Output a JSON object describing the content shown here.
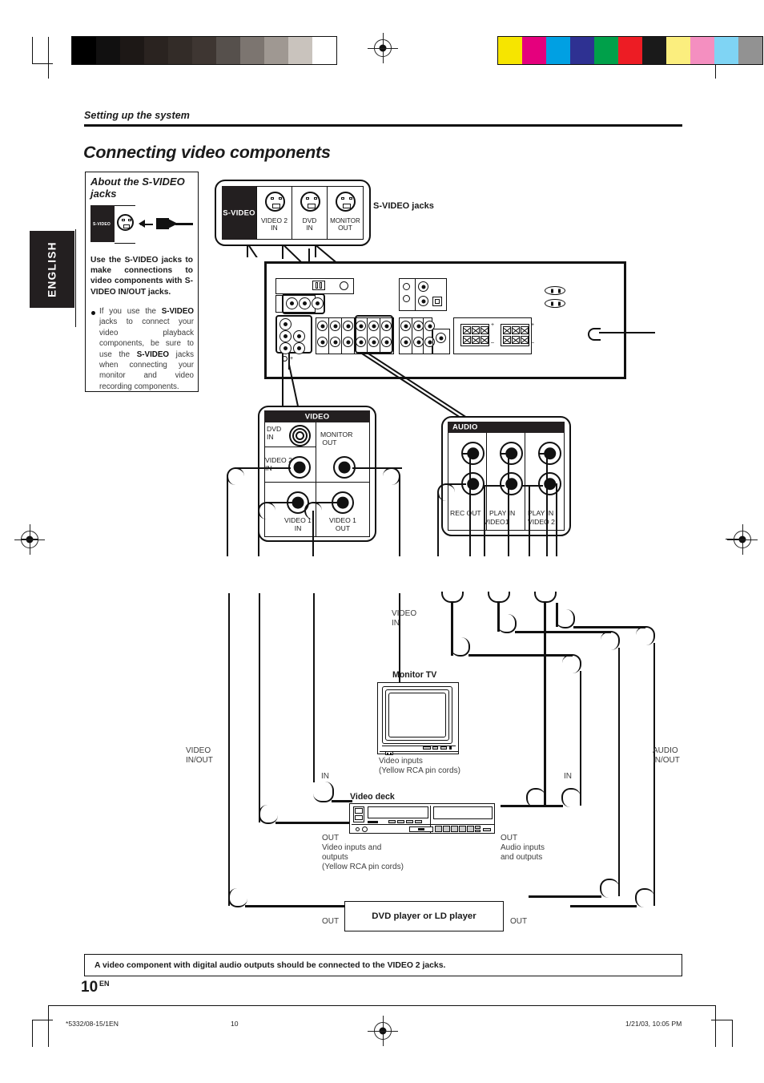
{
  "document": {
    "running_head": "Setting up the system",
    "title": "Connecting video components",
    "language_tab": "ENGLISH",
    "page_number": "10",
    "page_suffix": "EN"
  },
  "info_box": {
    "title": "About the S-VIDEO jacks",
    "mini_label": "S-VIDEO",
    "body": "Use the S-VIDEO jacks to make connections to video components with S-VIDEO IN/OUT jacks.",
    "bullet_html": "If you use the <b>S-VIDEO</b> jacks to connect your video playback components, be sure to use the <b>S-VIDEO</b> jacks when connecting your monitor and video recording components."
  },
  "svideo_panel": {
    "block_label": "S-VIDEO",
    "callout": "S-VIDEO jacks",
    "jacks": [
      {
        "line1": "VIDEO 2",
        "line2": "IN"
      },
      {
        "line1": "DVD",
        "line2": "IN"
      },
      {
        "line1": "MONITOR",
        "line2": "OUT"
      }
    ]
  },
  "video_panel": {
    "header": "VIDEO",
    "dvd_in_1": "DVD",
    "dvd_in_2": "IN",
    "monitor_out_1": "MONITOR",
    "monitor_out_2": "OUT",
    "video2_in_1": "VIDEO 2",
    "video2_in_2": "IN",
    "video1_in_1": "VIDEO 1",
    "video1_in_2": "IN",
    "video1_out_1": "VIDEO 1",
    "video1_out_2": "OUT"
  },
  "audio_panel": {
    "header": "AUDIO",
    "rec_out": "REC OUT",
    "play_in_1": "PLAY IN",
    "video1": "VIDEO1",
    "play_in_2": "PLAY IN",
    "video2": "VIDEO 2"
  },
  "diagram_labels": {
    "video_in_1": "VIDEO",
    "video_in_2": "IN",
    "video_inout_1": "VIDEO",
    "video_inout_2": "IN/OUT",
    "audio_inout_1": "AUDIO",
    "audio_inout_2": "IN/OUT",
    "in_left": "IN",
    "in_right": "IN",
    "out_left_deck": "OUT",
    "out_right_deck": "OUT",
    "out_left_dvd": "OUT",
    "out_right_dvd": "OUT",
    "monitor_tv": "Monitor TV",
    "monitor_caption_1": "Video inputs",
    "monitor_caption_2": "(Yellow RCA pin cords)",
    "video_deck": "Video deck",
    "deck_caption_1": "Video inputs and",
    "deck_caption_2": "outputs",
    "deck_caption_3": "(Yellow RCA pin cords)",
    "deck_audio_caption_1": "Audio inputs",
    "deck_audio_caption_2": "and outputs",
    "dvd_player": "DVD player or LD player"
  },
  "note": {
    "text": "A video component with digital audio outputs should be connected to the VIDEO 2 jacks."
  },
  "footer": {
    "left": "*5332/08-15/1EN",
    "center": "10",
    "right": "1/21/03, 10:05 PM"
  },
  "calibration": {
    "grayscale": [
      "#000000",
      "#111010",
      "#1d1816",
      "#2a2320",
      "#332c28",
      "#3e3632",
      "#56504c",
      "#7c7570",
      "#9f9892",
      "#c9c3bd",
      "#ffffff"
    ],
    "colors": [
      "#f6e500",
      "#e5007d",
      "#00a0e3",
      "#2e3192",
      "#00a04a",
      "#ed1c24",
      "#1a1a1a",
      "#fbee7e",
      "#f48fc0",
      "#7fd4f4",
      "#929292"
    ]
  }
}
